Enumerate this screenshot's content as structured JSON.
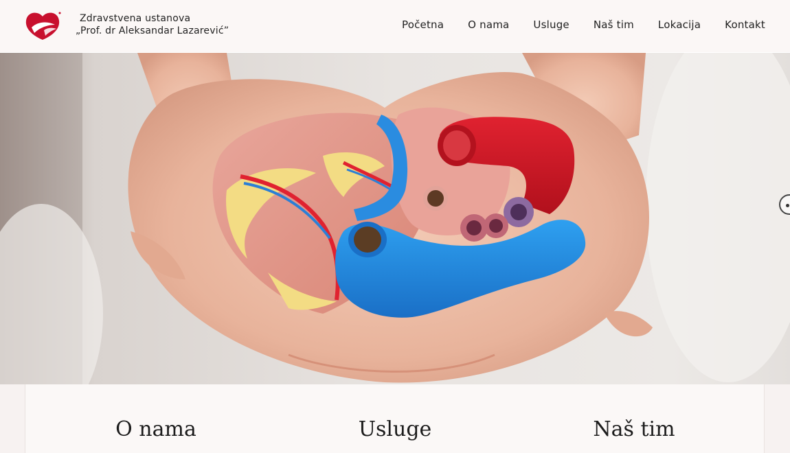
{
  "brand": {
    "line1": "Zdravstvena ustanova",
    "line2": "„Prof. dr Aleksandar Lazarević”",
    "logo_color": "#c8102e"
  },
  "nav": {
    "items": [
      "Početna",
      "O nama",
      "Usluge",
      "Naš tim",
      "Lokacija",
      "Kontakt"
    ]
  },
  "hero": {
    "image": "heart-model-in-hands",
    "next_icon": "chevron-right-icon"
  },
  "sections": {
    "titles": [
      "O nama",
      "Usluge",
      "Naš tim"
    ]
  }
}
